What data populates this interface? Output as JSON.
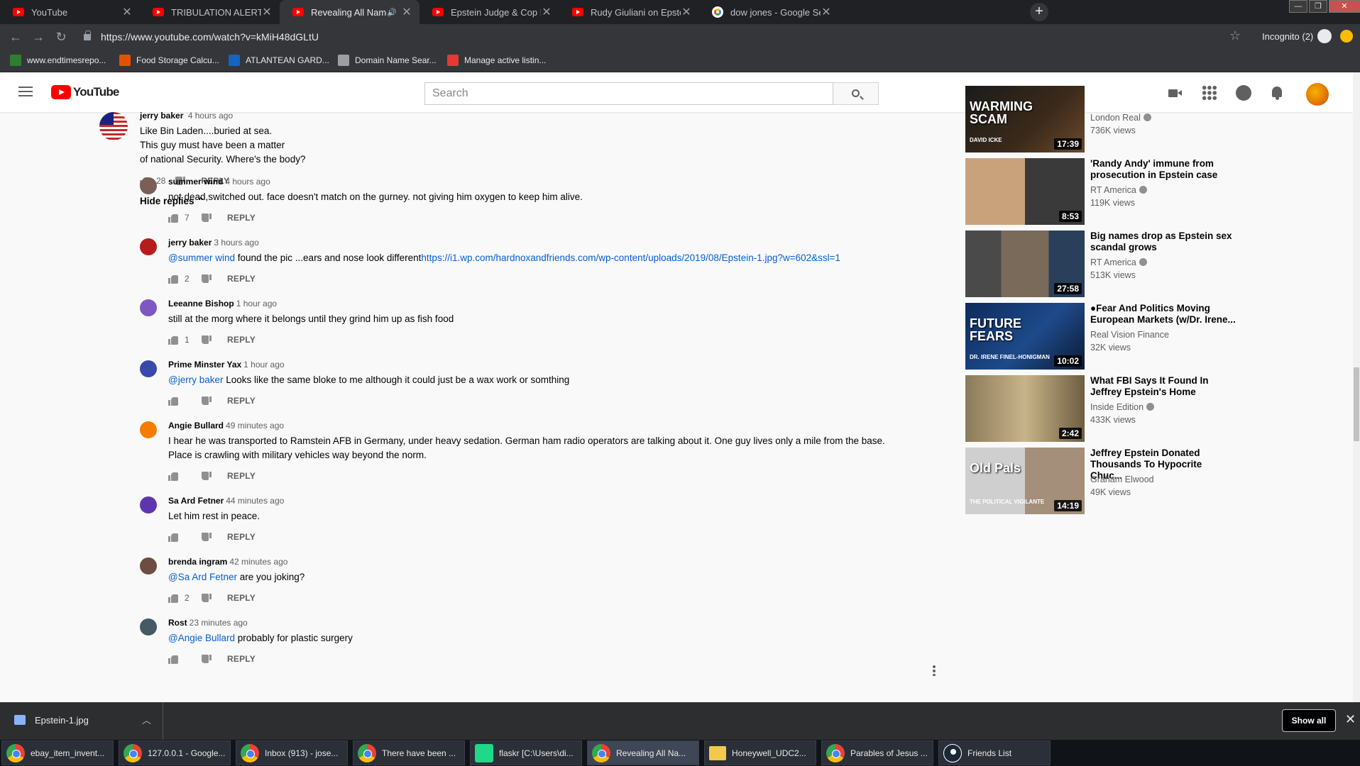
{
  "browser": {
    "tabs": [
      {
        "title": "YouTube",
        "icon": "youtube-favicon-icon",
        "active": false
      },
      {
        "title": "TRIBULATION ALERT!!! GLOBAL EL",
        "icon": "youtube-favicon-icon",
        "active": false
      },
      {
        "title": "Revealing All Names From Jeff",
        "icon": "youtube-favicon-icon",
        "active": true,
        "audio": "🔊"
      },
      {
        "title": "Epstein Judge & Cop Found Dead",
        "icon": "youtube-favicon-icon",
        "active": false
      },
      {
        "title": "Rudy Giuliani on Epstein's 'mind",
        "icon": "youtube-favicon-icon",
        "active": false
      },
      {
        "title": "dow jones - Google Search",
        "icon": "google-favicon-icon",
        "active": false
      }
    ],
    "tab_close_glyph": "✕",
    "new_tab_glyph": "+",
    "window_controls": {
      "minimize": "—",
      "maximize": "❐",
      "close": "✕"
    },
    "back_glyph": "←",
    "forward_glyph": "→",
    "reload_glyph": "↻",
    "url": "https://www.youtube.com/watch?v=kMiH48dGLtU",
    "star_glyph": "☆",
    "incognito_label": "Incognito (2)",
    "bookmarks": [
      {
        "label": "www.endtimesrepo...",
        "color": "#2e7d32"
      },
      {
        "label": "Food Storage Calcu...",
        "color": "#e65100"
      },
      {
        "label": "ATLANTEAN GARD...",
        "color": "#1565c0"
      },
      {
        "label": "Domain Name Sear...",
        "color": "#9e9e9e"
      },
      {
        "label": "Manage active listin...",
        "color": "#e53935"
      }
    ]
  },
  "youtube": {
    "logo_text": "YouTube",
    "search_placeholder": "Search"
  },
  "comments": {
    "top": {
      "author": "jerry baker",
      "time": "4 hours ago",
      "lines": [
        "Like Bin Laden....buried at sea.",
        "This guy must have been a matter",
        "of national Security. Where's the body?"
      ],
      "likes": "28",
      "reply_label": "REPLY"
    },
    "hide_replies_label": "Hide replies",
    "replies": [
      {
        "author": "summer wind",
        "time": "4 hours ago",
        "mention": "",
        "text": "not dead,switched out. face doesn't match on the gurney. not giving him oxygen to keep him alive.",
        "link": "",
        "likes": "7",
        "avatar_color": "#7b5e57"
      },
      {
        "author": "jerry baker",
        "time": "3 hours ago",
        "mention": "@summer wind",
        "text": " found the pic ...ears and nose look different",
        "link": "https://i1.wp.com/hardnoxandfriends.com/wp-content/uploads/2019/08/Epstein-1.jpg?w=602&ssl=1",
        "likes": "2",
        "avatar_color": "#b71c1c"
      },
      {
        "author": "Leeanne Bishop",
        "time": "1 hour ago",
        "mention": "",
        "text": "still at the morg where it belongs until they grind him up as fish food",
        "link": "",
        "likes": "1",
        "avatar_color": "#7e57c2"
      },
      {
        "author": "Prime Minster Yax",
        "time": "1 hour ago",
        "mention": "@jerry baker",
        "text": " Looks like the same bloke to me although it could just be a wax work or somthing",
        "link": "",
        "likes": "",
        "avatar_color": "#3949ab"
      },
      {
        "author": "Angie Bullard",
        "time": "49 minutes ago",
        "mention": "",
        "text": "I hear he was transported to Ramstein AFB in Germany, under heavy sedation. German ham radio operators are talking about it. One guy lives only a mile from the base.",
        "text2": "Place is crawling with military vehicles way beyond the norm.",
        "link": "",
        "likes": "",
        "avatar_color": "#f57c00"
      },
      {
        "author": "Sa Ard Fetner",
        "time": "44 minutes ago",
        "mention": "",
        "text": "Let him rest in peace.",
        "link": "",
        "likes": "",
        "avatar_color": "#5e35b1"
      },
      {
        "author": "brenda ingram",
        "time": "42 minutes ago",
        "mention": "@Sa Ard Fetner",
        "text": " are you joking?",
        "link": "",
        "likes": "2",
        "avatar_color": "#6d4c41"
      },
      {
        "author": "Rost",
        "time": "23 minutes ago",
        "mention": "@Angie Bullard",
        "text": " probably for plastic surgery",
        "link": "",
        "likes": "",
        "avatar_color": "#455a64"
      }
    ]
  },
  "sidebar": {
    "videos": [
      {
        "title": "",
        "channel": "London Real",
        "verified": true,
        "views": "736K views",
        "duration": "17:39",
        "thumb_text": "WARMING SCAM",
        "thumb_sub": "DAVID ICKE"
      },
      {
        "title": "'Randy Andy' immune from prosecution in Epstein case",
        "channel": "RT America",
        "verified": true,
        "views": "119K views",
        "duration": "8:53"
      },
      {
        "title": "Big names drop as Epstein sex scandal grows",
        "channel": "RT America",
        "verified": true,
        "views": "513K views",
        "duration": "27:58"
      },
      {
        "title": "●Fear And Politics Moving European Markets (w/Dr. Irene...",
        "channel": "Real Vision Finance",
        "verified": false,
        "views": "32K views",
        "duration": "10:02",
        "thumb_text": "FUTURE FEARS",
        "thumb_sub": "DR. IRENE FINEL-HONIGMAN"
      },
      {
        "title": "What FBI Says It Found In Jeffrey Epstein's Home",
        "channel": "Inside Edition",
        "verified": true,
        "views": "433K views",
        "duration": "2:42"
      },
      {
        "title": "Jeffrey Epstein Donated Thousands To Hypocrite Chuc...",
        "channel": "Graham Elwood",
        "verified": false,
        "views": "49K views",
        "duration": "14:19",
        "thumb_text": "Old Pals",
        "thumb_sub": "THE POLITICAL VIGILANTE"
      }
    ]
  },
  "downloads": {
    "file_name": "Epstein-1.jpg",
    "caret": "︿",
    "show_all_label": "Show all",
    "close_glyph": "✕"
  },
  "taskbar": {
    "items": [
      {
        "label": "ebay_item_invent...",
        "icon": "chrome",
        "active": false
      },
      {
        "label": "127.0.0.1 - Google...",
        "icon": "chrome",
        "active": false
      },
      {
        "label": "Inbox (913) - jose...",
        "icon": "chrome",
        "active": false
      },
      {
        "label": "There have been ...",
        "icon": "chrome",
        "active": false
      },
      {
        "label": "flaskr [C:\\Users\\di...",
        "icon": "pycharm",
        "active": false
      },
      {
        "label": "Revealing All Na...",
        "icon": "chrome",
        "active": true
      },
      {
        "label": "Honeywell_UDC2...",
        "icon": "folder",
        "active": false
      },
      {
        "label": "Parables of Jesus ...",
        "icon": "chrome",
        "active": false
      },
      {
        "label": "Friends List",
        "icon": "steam",
        "active": false
      }
    ]
  }
}
